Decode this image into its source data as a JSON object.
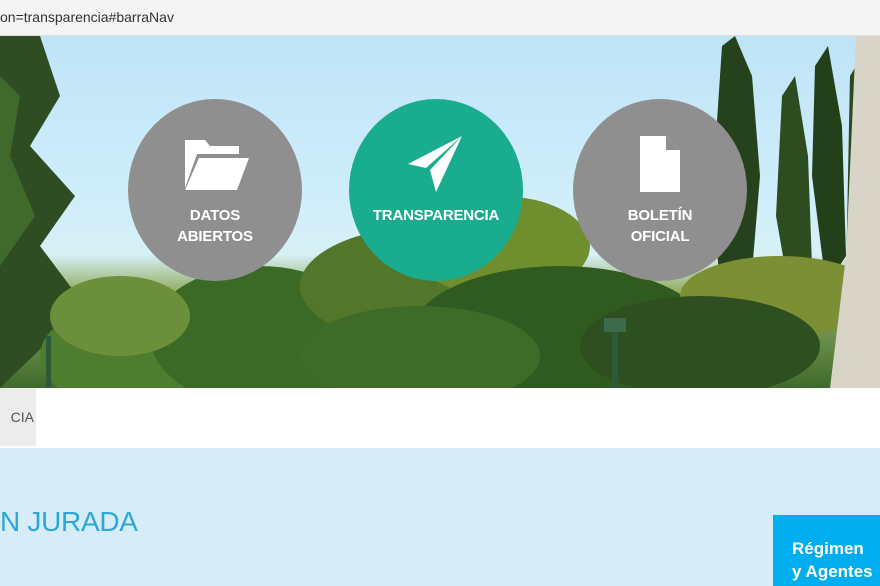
{
  "browser": {
    "url": "on=transparencia#barraNav"
  },
  "hero": {
    "items": [
      {
        "line1": "DATOS",
        "line2": "ABIERTOS",
        "icon": "folder-icon",
        "color": "#8f8f8f"
      },
      {
        "line1": "TRANSPARENCIA",
        "line2": "",
        "icon": "paper-plane-icon",
        "color": "#1aac8f"
      },
      {
        "line1": "BOLETÍN",
        "line2": "OFICIAL",
        "icon": "document-icon",
        "color": "#8f8f8f"
      }
    ]
  },
  "nav": {
    "active_tab": "CIA"
  },
  "main": {
    "section_title": "N JURADA",
    "side_card": {
      "line1": "Régimen",
      "line2": "y Agentes"
    }
  },
  "colors": {
    "accent": "#1aac8f",
    "title": "#2ba7d9",
    "card": "#00adef",
    "content_bg": "#d7ecf9"
  }
}
